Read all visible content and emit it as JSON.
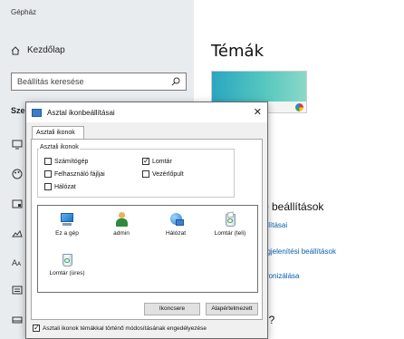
{
  "app": {
    "title": "Gépház"
  },
  "sidebar": {
    "home_label": "Kezdőlap",
    "search_placeholder": "Beállítás keresése",
    "section_heading": "Sze",
    "icons": [
      "monitor-icon",
      "palette-icon",
      "window-icon",
      "image-icon",
      "font-icon",
      "keyboard-icon",
      "taskbar-icon"
    ]
  },
  "main": {
    "title": "Témák",
    "related_heading": "ó beállítások",
    "link_1": "állításai",
    "link_2": "egjelenítési beállítások",
    "link_3": "kronizálása",
    "question": "n?"
  },
  "dialog": {
    "title": "Asztal ikonbeállításai",
    "close_glyph": "✕",
    "tab_label": "Asztali ikonok",
    "group_label": "Asztali ikonok",
    "checkboxes": [
      {
        "label": "Számítógép",
        "checked": ""
      },
      {
        "label": "Lomtár",
        "checked": "✓"
      },
      {
        "label": "Felhasználó fájljai",
        "checked": ""
      },
      {
        "label": "Vezérlőpult",
        "checked": ""
      },
      {
        "label": "Hálózat",
        "checked": ""
      }
    ],
    "desktop_icons": [
      {
        "label": "Ez a gép",
        "icon": "computer-icon"
      },
      {
        "label": "admin",
        "icon": "user-folder-icon"
      },
      {
        "label": "Hálózat",
        "icon": "network-icon"
      },
      {
        "label": "Lomtár (teli)",
        "icon": "recycle-bin-full-icon"
      },
      {
        "label": "Lomtár (üres)",
        "icon": "recycle-bin-empty-icon"
      }
    ],
    "change_icon_button": "Ikoncsere",
    "default_button": "Alapértelmezett",
    "bottom_checkbox": {
      "label": "Asztali ikonok témákkal történő módosításának engedélyezése",
      "checked": "✓"
    }
  }
}
